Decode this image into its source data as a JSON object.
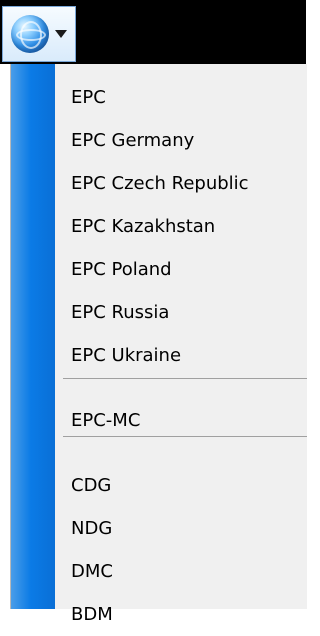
{
  "menu": {
    "groups": [
      [
        "EPC",
        "EPC Germany",
        "EPC Czech Republic",
        "EPC Kazakhstan",
        "EPC Poland",
        "EPC Russia",
        "EPC Ukraine"
      ],
      [
        "EPC-MC"
      ],
      [
        "CDG",
        "NDG",
        "DMC",
        "BDM"
      ]
    ]
  },
  "icons": {
    "menu_button": "globe-icon",
    "dropdown": "chevron-down-icon"
  },
  "colors": {
    "topbar": "#000000",
    "menu_bg": "#f0f0f0",
    "strip": "#0b7be6",
    "separator": "#a0a0a0"
  }
}
